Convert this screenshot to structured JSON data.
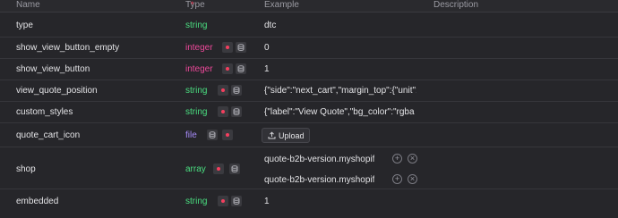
{
  "columns": {
    "name": "Name",
    "type": "Type",
    "example": "Example",
    "description": "Description"
  },
  "rows": [
    {
      "name": "type",
      "type": "string",
      "example": "dtc"
    },
    {
      "name": "show_view_button_empty",
      "type": "integer",
      "example": "0"
    },
    {
      "name": "show_view_button",
      "type": "integer",
      "example": "1"
    },
    {
      "name": "view_quote_position",
      "type": "string",
      "example": "{\"side\":\"next_cart\",\"margin_top\":{\"unit\":\""
    },
    {
      "name": "custom_styles",
      "type": "string",
      "example": "{\"label\":\"View Quote\",\"bg_color\":\"rgba"
    },
    {
      "name": "quote_cart_icon",
      "type": "file",
      "example": ""
    },
    {
      "name": "shop",
      "type": "array",
      "example": ""
    },
    {
      "name": "embedded",
      "type": "string",
      "example": "1"
    }
  ],
  "upload_label": "Upload",
  "shop_items": [
    "quote-b2b-version.myshopif",
    "quote-b2b-version.myshopif"
  ],
  "colors": {
    "string": "#4ade80",
    "integer": "#ec4899",
    "file": "#a78bfa",
    "required": "#f43f5e"
  }
}
